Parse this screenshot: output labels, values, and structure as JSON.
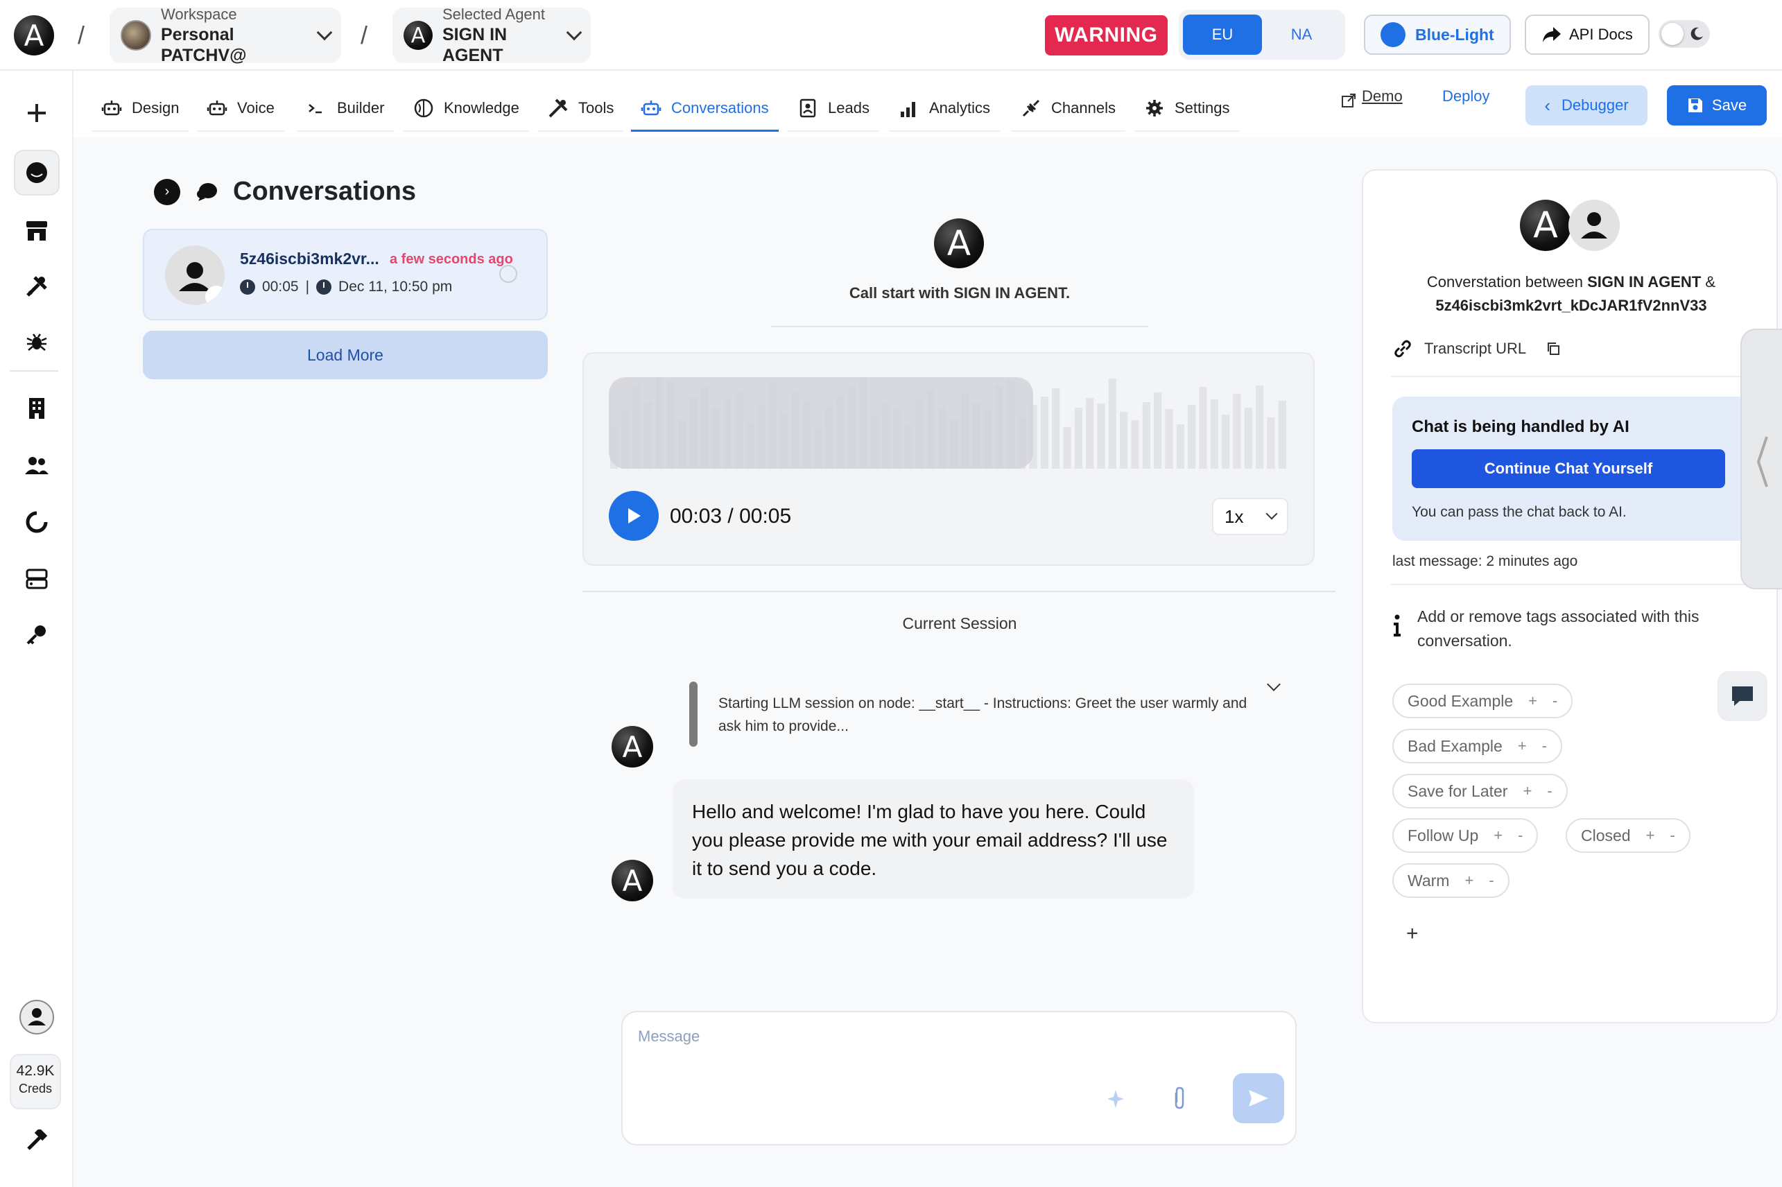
{
  "topbar": {
    "logo_letter": "A",
    "workspace": {
      "label": "Workspace",
      "value": "Personal PATCHV@"
    },
    "agent": {
      "label": "Selected Agent",
      "value": "SIGN IN AGENT"
    },
    "warning": "WARNING",
    "regions": [
      {
        "label": "EU",
        "active": true
      },
      {
        "label": "NA",
        "active": false
      }
    ],
    "theme": "Blue-Light",
    "api_docs": "API Docs",
    "separator": "/"
  },
  "rail": {
    "credits_value": "42.9K",
    "credits_label": "Creds",
    "icons": [
      "add-icon",
      "smiley-icon",
      "store-icon",
      "tools-icon",
      "bug-icon",
      "building-icon",
      "users-icon",
      "loader-icon",
      "server-icon",
      "key-icon",
      "user-icon",
      "hammer-icon"
    ]
  },
  "nav": {
    "tabs": [
      {
        "label": "Design",
        "icon": "robot-icon"
      },
      {
        "label": "Voice",
        "icon": "robot-voice-icon"
      },
      {
        "label": "Builder",
        "icon": "terminal-icon"
      },
      {
        "label": "Knowledge",
        "icon": "brain-icon"
      },
      {
        "label": "Tools",
        "icon": "tools-icon"
      },
      {
        "label": "Conversations",
        "icon": "robot-chat-icon",
        "active": true
      },
      {
        "label": "Leads",
        "icon": "contact-icon"
      },
      {
        "label": "Analytics",
        "icon": "bar-chart-icon"
      },
      {
        "label": "Channels",
        "icon": "plug-icon"
      },
      {
        "label": "Settings",
        "icon": "gear-icon"
      }
    ],
    "demo": "Demo",
    "deploy": "Deploy",
    "debugger": "Debugger",
    "save": "Save"
  },
  "conversations": {
    "title": "Conversations",
    "items": [
      {
        "id": "5z46iscbi3mk2vr...",
        "ago": "a few seconds ago",
        "duration": "00:05",
        "sep": "|",
        "date": "Dec 11, 10:50 pm"
      }
    ],
    "load_more": "Load More"
  },
  "call": {
    "start_text": "Call start with SIGN IN AGENT.",
    "player": {
      "time": "00:03 / 00:05",
      "speed": "1x",
      "progress": 0.6
    },
    "session_label": "Current Session",
    "log": "Starting LLM session on node: __start__ - Instructions: Greet the user warmly and ask him to provide...",
    "message": "Hello and welcome! I'm glad to have you here. Could you please provide me with your email address? I'll use it to send you a code.",
    "composer_placeholder": "Message"
  },
  "details": {
    "between_prefix": "Converstation between ",
    "agent_name": "SIGN IN AGENT",
    "amp": " &",
    "user_id": "5z46iscbi3mk2vrt_kDcJAR1fV2nnV33",
    "transcript_label": "Transcript URL",
    "ai_title": "Chat is being handled by AI",
    "continue_button": "Continue Chat Yourself",
    "ai_note": "You can pass the chat back to AI.",
    "last_message": "last message: 2 minutes ago",
    "tags_info": "Add or remove tags associated with this conversation.",
    "tags": [
      "Good Example",
      "Bad Example",
      "Save for Later",
      "Follow Up",
      "Closed",
      "Warm"
    ],
    "plus": "+",
    "minus": "-"
  },
  "colors": {
    "accent": "#1f6fe5",
    "warning": "#e3294f",
    "ago": "#e4466c"
  }
}
